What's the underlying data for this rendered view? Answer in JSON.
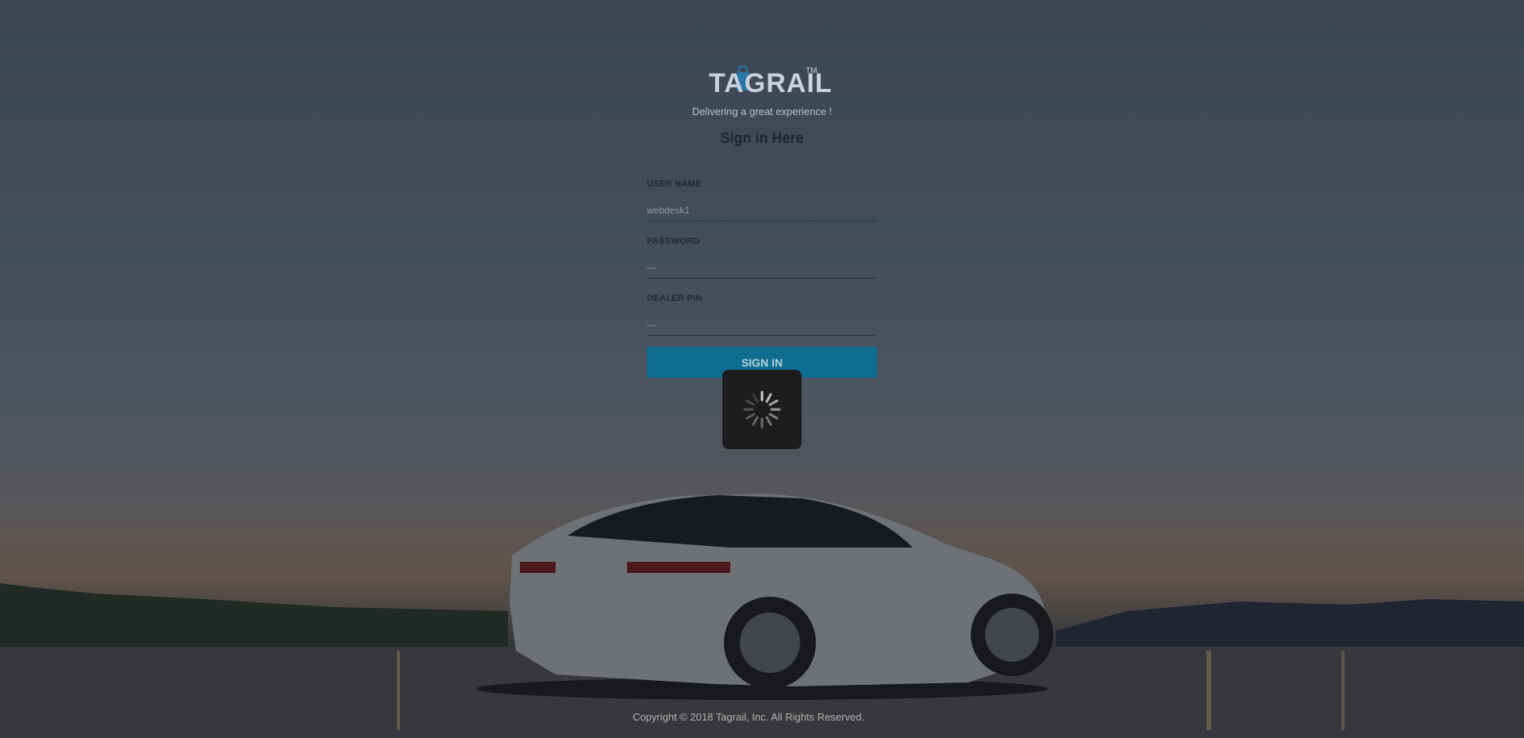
{
  "brand": {
    "logo_text": "TAGRAIL",
    "tm": "TM",
    "tagline": "Delivering a great experience !"
  },
  "form": {
    "title": "Sign in Here",
    "username_label": "USER NAME",
    "username_value": "webdesk1",
    "password_label": "PASSWORD",
    "password_value": "—",
    "dealerpin_label": "DEALER PIN",
    "dealerpin_value": "—",
    "submit_label": "SIGN IN"
  },
  "loading": {
    "icon": "spinner-icon"
  },
  "footer": {
    "copyright": "Copyright © 2018 Tagrail, Inc. All Rights Reserved."
  },
  "colors": {
    "accent": "#0f6d8f",
    "title": "#1b232e"
  }
}
